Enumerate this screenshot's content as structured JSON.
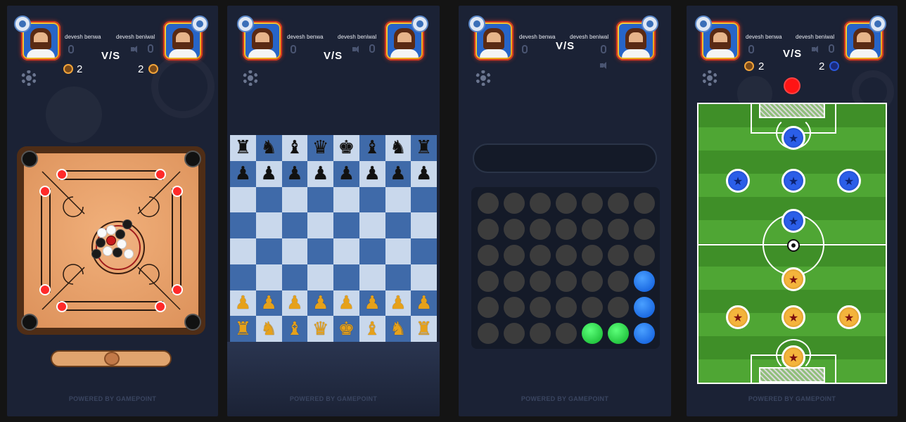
{
  "players": {
    "left_name": "devesh benwa",
    "right_name": "devesh beniwal",
    "versus": "V/S"
  },
  "screens": [
    {
      "game": "carrom",
      "left_score": "2",
      "right_score": "2"
    },
    {
      "game": "chess"
    },
    {
      "game": "connect-four"
    },
    {
      "game": "football",
      "left_score": "2",
      "right_score": "2"
    }
  ],
  "footer": "POWERED BY GAMEPOINT",
  "chess": {
    "rows": [
      [
        "♜",
        "♞",
        "♝",
        "♛",
        "♚",
        "♝",
        "♞",
        "♜"
      ],
      [
        "♟",
        "♟",
        "♟",
        "♟",
        "♟",
        "♟",
        "♟",
        "♟"
      ],
      [
        "",
        "",
        "",
        "",
        "",
        "",
        "",
        ""
      ],
      [
        "",
        "",
        "",
        "",
        "",
        "",
        "",
        ""
      ],
      [
        "",
        "",
        "",
        "",
        "",
        "",
        "",
        ""
      ],
      [
        "",
        "",
        "",
        "",
        "",
        "",
        "",
        ""
      ],
      [
        "♟",
        "♟",
        "♟",
        "♟",
        "♟",
        "♟",
        "♟",
        "♟"
      ],
      [
        "♜",
        "♞",
        "♝",
        "♛",
        "♚",
        "♝",
        "♞",
        "♜"
      ]
    ]
  },
  "connect_four": {
    "rows": [
      [
        "e",
        "e",
        "e",
        "e",
        "e",
        "e",
        "e"
      ],
      [
        "e",
        "e",
        "e",
        "e",
        "e",
        "e",
        "e"
      ],
      [
        "e",
        "e",
        "e",
        "e",
        "e",
        "e",
        "e"
      ],
      [
        "e",
        "e",
        "e",
        "e",
        "e",
        "e",
        "blue"
      ],
      [
        "e",
        "e",
        "e",
        "e",
        "e",
        "e",
        "blue"
      ],
      [
        "e",
        "e",
        "e",
        "e",
        "green",
        "green",
        "blue"
      ]
    ]
  },
  "colors": {
    "accent_blue": "#2b5ee8",
    "accent_gold": "#f4b43c",
    "background": "#1b2235"
  },
  "icons": {
    "settings": "gear-icon",
    "mic": "mic-icon",
    "sound": "speaker-icon",
    "coin": "coin-icon"
  }
}
